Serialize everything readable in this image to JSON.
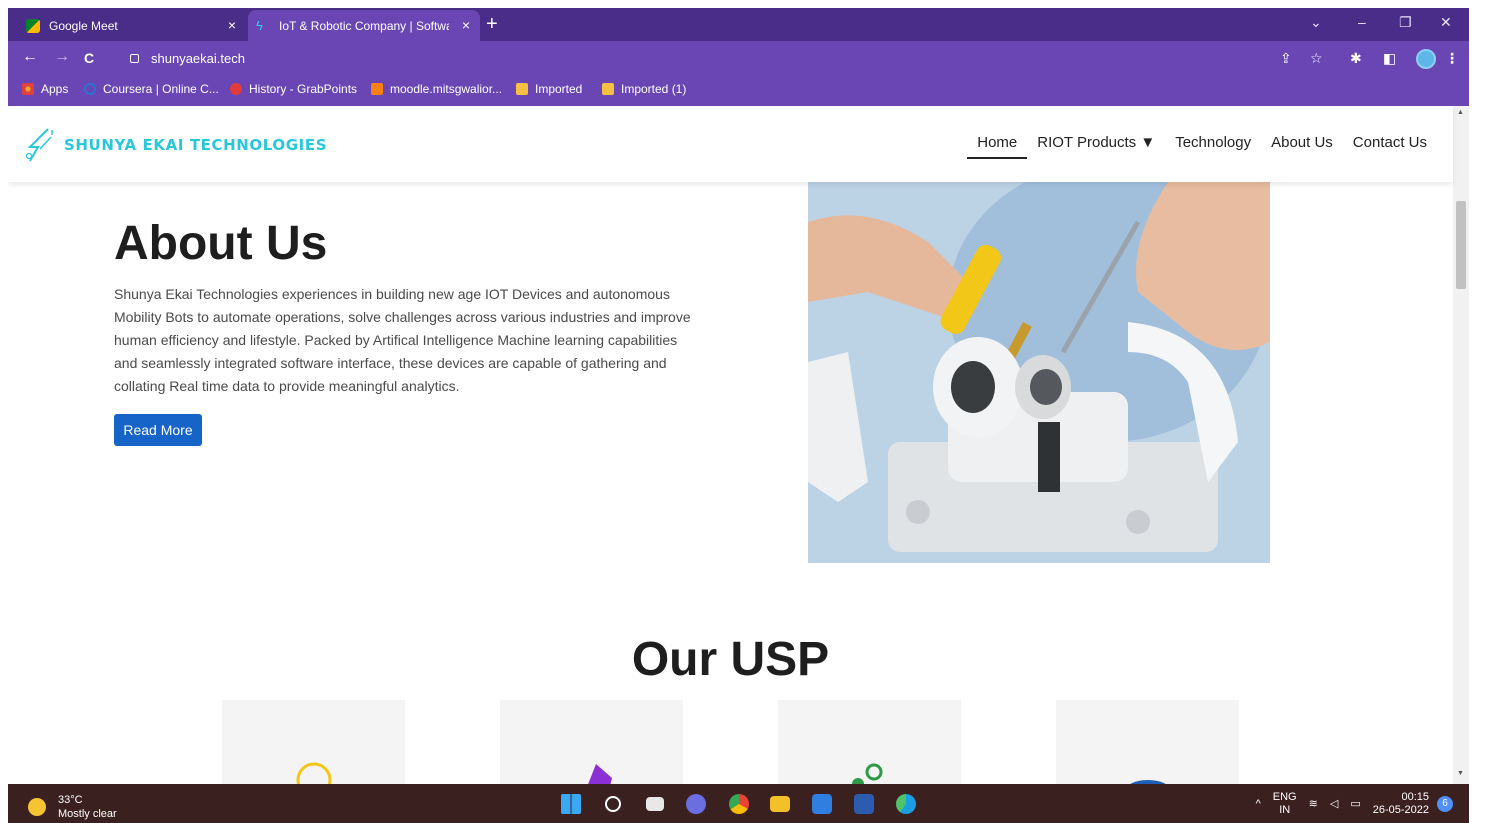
{
  "browser": {
    "tabs": [
      {
        "title": "Google Meet",
        "close": "×"
      },
      {
        "title": "IoT & Robotic Company | Softwa",
        "close": "×"
      }
    ],
    "new_tab": "+",
    "window_buttons": [
      "⌄",
      "–",
      "❐",
      "✕"
    ],
    "address": "shunyaekai.tech",
    "nav": {
      "back": "←",
      "forward": "→",
      "reload": "C"
    },
    "toolbar_icons": {
      "share": "⇪",
      "star": "☆",
      "extensions": "✱",
      "side_panel": "◧",
      "menu": "⋮"
    },
    "bookmarks": [
      {
        "label": "Apps",
        "icon": "apps-grid-icon",
        "color": "#f2a52b"
      },
      {
        "label": "Coursera | Online C...",
        "icon": "coursera-icon",
        "color": "#2a73cc"
      },
      {
        "label": "History - GrabPoints",
        "icon": "grabpoints-icon",
        "color": "#e23b3b"
      },
      {
        "label": "moodle.mitsgwalior...",
        "icon": "moodle-icon",
        "color": "#f98012"
      },
      {
        "label": "Imported",
        "icon": "folder-icon",
        "color": "#f6c142"
      },
      {
        "label": "Imported (1)",
        "icon": "folder-icon",
        "color": "#f6c142"
      }
    ],
    "accent": "#6a46b5",
    "tabstrip_color": "#4a2c89"
  },
  "site": {
    "logo_text": "SHUNYA EKAI TECHNOLOGIES",
    "nav": [
      {
        "label": "Home",
        "active": true
      },
      {
        "label": "RIOT Products ▼",
        "active": false
      },
      {
        "label": "Technology",
        "active": false
      },
      {
        "label": "About Us",
        "active": false
      },
      {
        "label": "Contact Us",
        "active": false
      }
    ],
    "about": {
      "heading": "About Us",
      "text": "Shunya Ekai Technologies experiences in building new age IOT Devices and autonomous Mobility Bots to automate operations, solve challenges across various industries and improve human efficiency and lifestyle. Packed by Artifical Intelligence Machine learning capabilities and seamlessly integrated software interface, these devices are capable of gathering and collating Real time data to provide meaningful analytics.",
      "button": "Read More"
    },
    "usp": {
      "heading": "Our USP"
    },
    "brand_color": "#28c7dc",
    "button_color": "#1664c7"
  },
  "taskbar": {
    "weather": {
      "temp": "33°C",
      "desc": "Mostly clear"
    },
    "lang": {
      "line1": "ENG",
      "line2": "IN"
    },
    "time": "00:15",
    "date": "26-05-2022",
    "notifications": "6",
    "chevron": "^"
  }
}
